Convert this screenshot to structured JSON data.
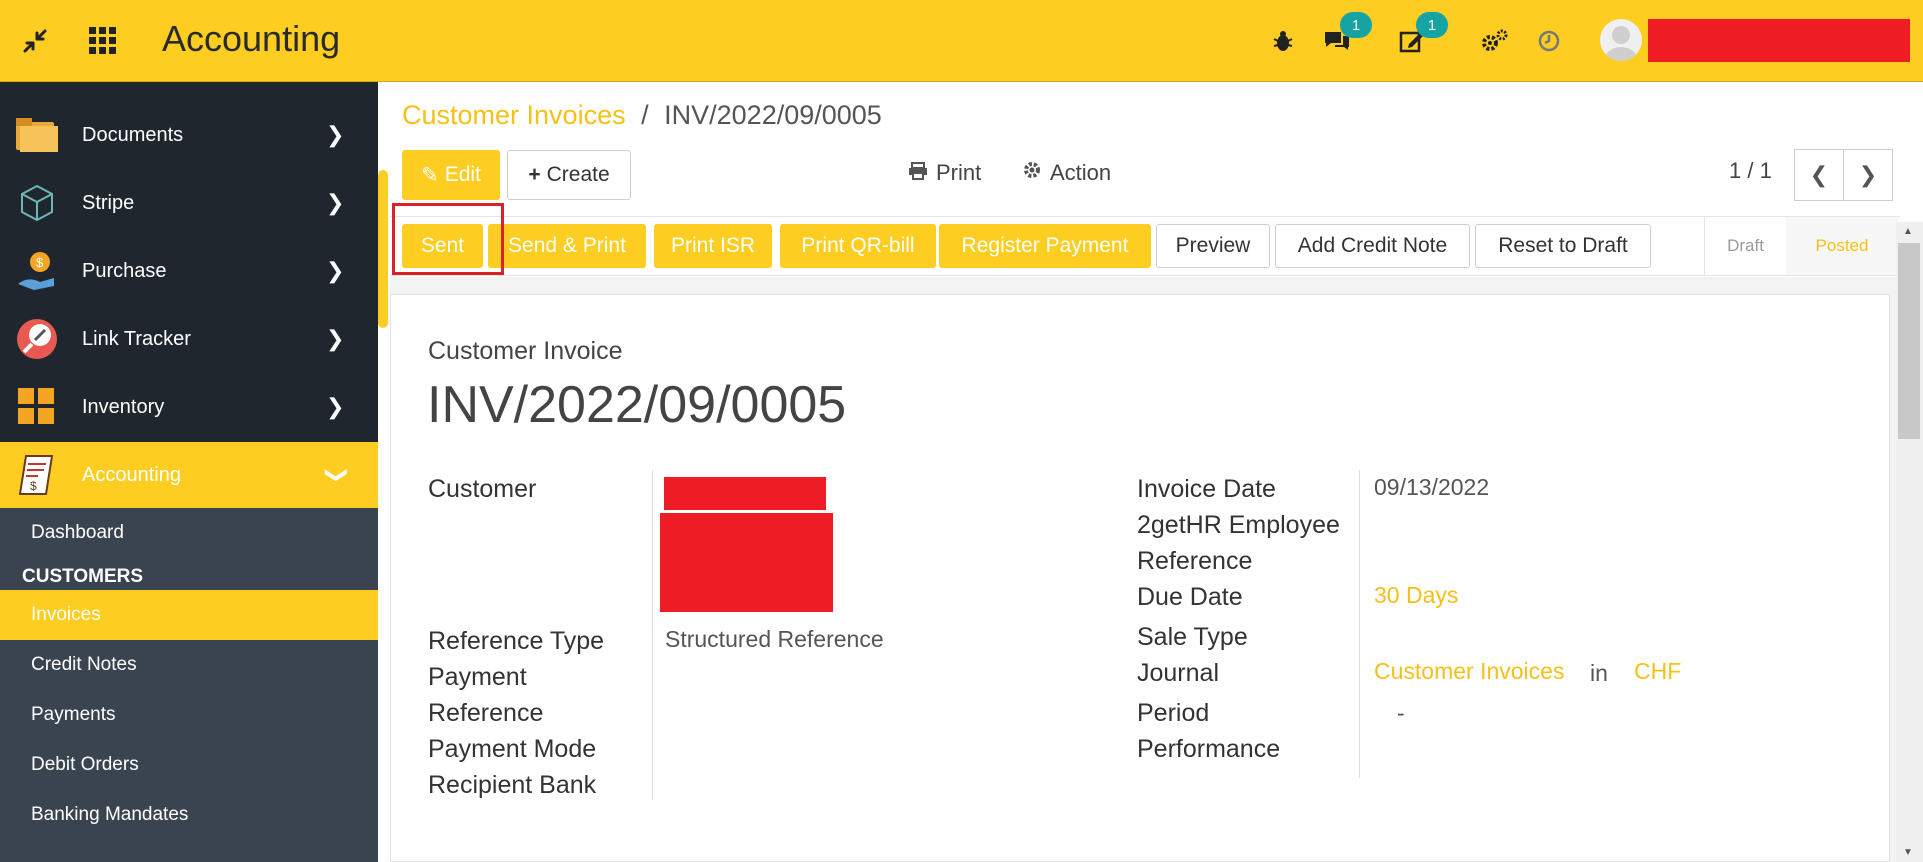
{
  "app": {
    "title": "Accounting"
  },
  "topbar": {
    "messages_badge": "1",
    "activities_badge": "1"
  },
  "sidebar": {
    "items": [
      {
        "label": "Documents"
      },
      {
        "label": "Stripe"
      },
      {
        "label": "Purchase"
      },
      {
        "label": "Link Tracker"
      },
      {
        "label": "Inventory"
      },
      {
        "label": "Accounting"
      }
    ],
    "sub": {
      "dashboard": "Dashboard",
      "customers_heading": "CUSTOMERS",
      "invoices": "Invoices",
      "credit_notes": "Credit Notes",
      "payments": "Payments",
      "debit_orders": "Debit Orders",
      "banking_mandates": "Banking Mandates"
    }
  },
  "breadcrumb": {
    "parent": "Customer Invoices",
    "separator": "/",
    "current": "INV/2022/09/0005"
  },
  "controls": {
    "edit": "Edit",
    "create": "Create",
    "print": "Print",
    "action": "Action",
    "pager": "1 / 1"
  },
  "status_buttons": {
    "sent": "Sent",
    "send_print": "Send & Print",
    "print_isr": "Print ISR",
    "print_qr": "Print QR-bill",
    "register_payment": "Register Payment",
    "preview": "Preview",
    "add_credit_note": "Add Credit Note",
    "reset_draft": "Reset to Draft"
  },
  "stages": {
    "draft": "Draft",
    "posted": "Posted"
  },
  "form": {
    "doc_type": "Customer Invoice",
    "number": "INV/2022/09/0005",
    "customer_label": "Customer",
    "reference_type_label": "Reference Type",
    "reference_type_value": "Structured Reference",
    "payment_reference_label": "Payment Reference",
    "payment_mode_label": "Payment Mode",
    "recipient_bank_label": "Recipient Bank",
    "invoice_date_label": "Invoice Date",
    "invoice_date_value": "09/13/2022",
    "employee_ref_label": "2getHR Employee Reference",
    "due_date_label": "Due Date",
    "due_date_value": "30 Days",
    "sale_type_label": "Sale Type",
    "journal_label": "Journal",
    "journal_value": "Customer Invoices",
    "journal_in": "in",
    "currency": "CHF",
    "period_label": "Period Performance",
    "period_value": "-"
  },
  "colors": {
    "brand": "#fdcd22",
    "sidebar": "#1f262e",
    "badge": "#15a3a3"
  }
}
